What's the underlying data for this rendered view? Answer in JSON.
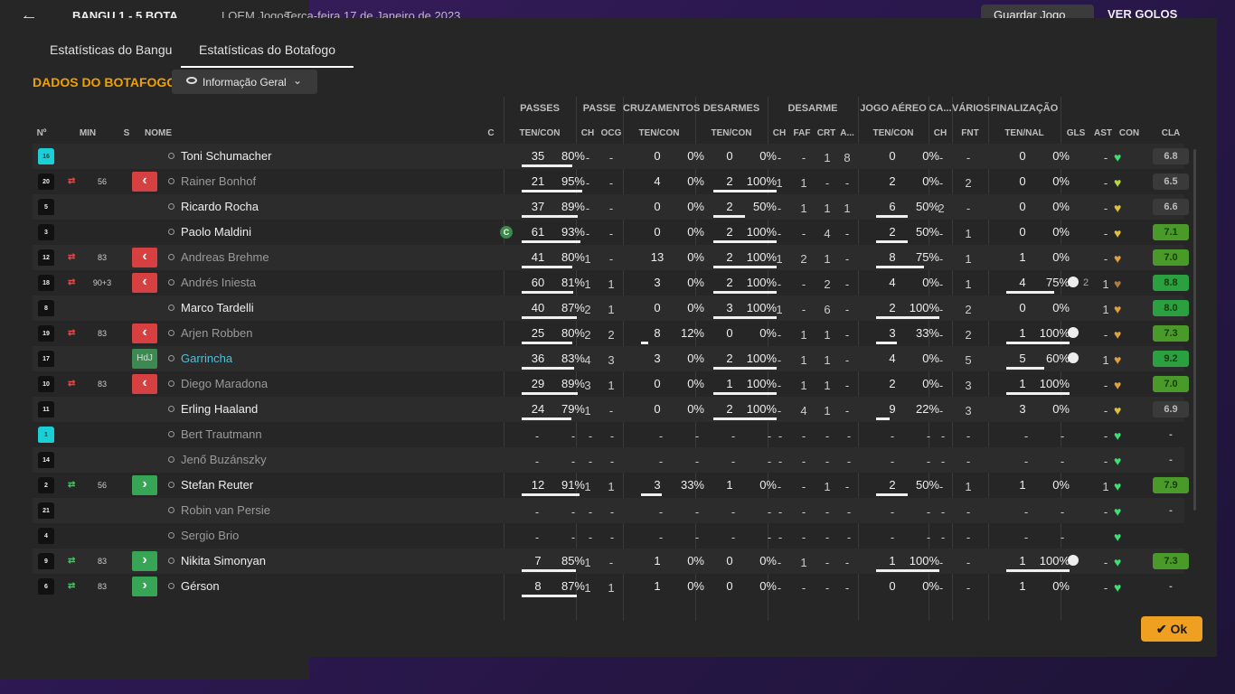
{
  "topbar": {
    "score": "BANGU  1 - 5  BOTA",
    "competition": "LOEM Jogos",
    "date": "Terça-feira 17 de Janeiro de 2023",
    "save_label": "Guardar Jogo",
    "more_label": "VER GOLOS"
  },
  "tabs": [
    {
      "label": "Estatísticas do Bangu",
      "active": false
    },
    {
      "label": "Estatísticas do Botafogo",
      "active": true
    }
  ],
  "section_title": "DADOS DO BOTAFOGO",
  "view_dropdown": {
    "selected": "Informação Geral"
  },
  "groups": {
    "passes": "PASSES",
    "passe": "PASSE",
    "cruzamentos": "CRUZAMENTOS",
    "desarmes1": "DESARMES",
    "desarme": "DESARME",
    "jogo_aereo": "JOGO AÉREO",
    "ca": "CA...",
    "varios": "VÁRIOS",
    "finalizacao": "FINALIZAÇÃO"
  },
  "columns": {
    "no": "Nº",
    "min": "MIN",
    "s": "S",
    "nome": "NOME",
    "c": "C",
    "passes_ten": "TEN/CON",
    "passe_ch": "CH",
    "passe_ocg": "OCG",
    "cruz_ten": "TEN/CON",
    "des_ten": "TEN/CON",
    "dese_ch": "CH",
    "dese_faf": "FAF",
    "dese_crt": "CRT",
    "dese_a": "A...",
    "aereo_ten": "TEN/CON",
    "ca_ch": "CH",
    "var_fnt": "FNT",
    "fin_ten": "TEN/NAL",
    "gls": "GLS",
    "ast": "AST",
    "con": "CON",
    "cla": "CLA"
  },
  "players": [
    {
      "no": "16",
      "gk": true,
      "sub": "",
      "min": "",
      "s": "",
      "name": "Toni Schumacher",
      "style": "normal",
      "captain": false,
      "pas": [
        "35",
        "80%"
      ],
      "pasw": 0.8,
      "ch": "-",
      "ocg": "-",
      "cru": [
        "0",
        "0%"
      ],
      "cruw": 0,
      "des": [
        "0",
        "0%"
      ],
      "desw": 0,
      "dch": "-",
      "faf": "-",
      "crt": "1",
      "aa": "8",
      "aer": [
        "0",
        "0%"
      ],
      "aerw": 0,
      "cach": "-",
      "fnt": "-",
      "fin": [
        "0",
        "0%"
      ],
      "finw": 0,
      "gls": "",
      "ast": "-",
      "heart": "#3ce070",
      "rating": "6.8",
      "rbg": "#3a3a3a"
    },
    {
      "no": "20",
      "gk": false,
      "sub": "out",
      "min": "56",
      "s": "red",
      "name": "Rainer Bonhof",
      "style": "dim",
      "captain": false,
      "pas": [
        "21",
        "95%"
      ],
      "pasw": 0.95,
      "ch": "-",
      "ocg": "-",
      "cru": [
        "4",
        "0%"
      ],
      "cruw": 0,
      "des": [
        "2",
        "100%"
      ],
      "desw": 1,
      "dch": "1",
      "faf": "1",
      "crt": "-",
      "aa": "-",
      "aer": [
        "2",
        "0%"
      ],
      "aerw": 0,
      "cach": "-",
      "fnt": "2",
      "fin": [
        "0",
        "0%"
      ],
      "finw": 0,
      "gls": "",
      "ast": "-",
      "heart": "#b5d840",
      "rating": "6.5",
      "rbg": "#3a3a3a"
    },
    {
      "no": "5",
      "gk": false,
      "sub": "",
      "min": "",
      "s": "",
      "name": "Ricardo Rocha",
      "style": "normal",
      "captain": false,
      "pas": [
        "37",
        "89%"
      ],
      "pasw": 0.89,
      "ch": "-",
      "ocg": "-",
      "cru": [
        "0",
        "0%"
      ],
      "cruw": 0,
      "des": [
        "2",
        "50%"
      ],
      "desw": 0.5,
      "dch": "-",
      "faf": "1",
      "crt": "1",
      "aa": "1",
      "aer": [
        "6",
        "50%"
      ],
      "aerw": 0.5,
      "cach": "2",
      "fnt": "-",
      "fin": [
        "0",
        "0%"
      ],
      "finw": 0,
      "gls": "",
      "ast": "-",
      "heart": "#e0c040",
      "rating": "6.6",
      "rbg": "#3a3a3a"
    },
    {
      "no": "3",
      "gk": false,
      "sub": "",
      "min": "",
      "s": "",
      "name": "Paolo Maldini",
      "style": "normal",
      "captain": true,
      "pas": [
        "61",
        "93%"
      ],
      "pasw": 0.93,
      "ch": "-",
      "ocg": "-",
      "cru": [
        "0",
        "0%"
      ],
      "cruw": 0,
      "des": [
        "2",
        "100%"
      ],
      "desw": 1,
      "dch": "-",
      "faf": "-",
      "crt": "4",
      "aa": "-",
      "aer": [
        "2",
        "50%"
      ],
      "aerw": 0.5,
      "cach": "-",
      "fnt": "1",
      "fin": [
        "0",
        "0%"
      ],
      "finw": 0,
      "gls": "",
      "ast": "-",
      "heart": "#e0c040",
      "rating": "7.1",
      "rbg": "#4a9a2a"
    },
    {
      "no": "12",
      "gk": false,
      "sub": "out",
      "min": "83",
      "s": "red",
      "name": "Andreas Brehme",
      "style": "dim",
      "captain": false,
      "pas": [
        "41",
        "80%"
      ],
      "pasw": 0.8,
      "ch": "1",
      "ocg": "-",
      "cru": [
        "13",
        "0%"
      ],
      "cruw": 0,
      "des": [
        "2",
        "100%"
      ],
      "desw": 1,
      "dch": "1",
      "faf": "2",
      "crt": "1",
      "aa": "-",
      "aer": [
        "8",
        "75%"
      ],
      "aerw": 0.75,
      "cach": "-",
      "fnt": "1",
      "fin": [
        "1",
        "0%"
      ],
      "finw": 0,
      "gls": "",
      "ast": "-",
      "heart": "#e0a040",
      "rating": "7.0",
      "rbg": "#4a9a2a"
    },
    {
      "no": "18",
      "gk": false,
      "sub": "out",
      "min": "90+3",
      "s": "red",
      "name": "Andrés Iniesta",
      "style": "dim",
      "captain": false,
      "pas": [
        "60",
        "81%"
      ],
      "pasw": 0.81,
      "ch": "1",
      "ocg": "1",
      "cru": [
        "3",
        "0%"
      ],
      "cruw": 0,
      "des": [
        "2",
        "100%"
      ],
      "desw": 1,
      "dch": "-",
      "faf": "-",
      "crt": "2",
      "aa": "-",
      "aer": [
        "4",
        "0%"
      ],
      "aerw": 0,
      "cach": "-",
      "fnt": "1",
      "fin": [
        "4",
        "75%"
      ],
      "finw": 0.75,
      "gls": "2",
      "ast": "1",
      "heart": "#b07a40",
      "rating": "8.8",
      "rbg": "#2aa040"
    },
    {
      "no": "8",
      "gk": false,
      "sub": "",
      "min": "",
      "s": "",
      "name": "Marco Tardelli",
      "style": "normal",
      "captain": false,
      "pas": [
        "40",
        "87%"
      ],
      "pasw": 0.87,
      "ch": "2",
      "ocg": "1",
      "cru": [
        "0",
        "0%"
      ],
      "cruw": 0,
      "des": [
        "3",
        "100%"
      ],
      "desw": 1,
      "dch": "1",
      "faf": "-",
      "crt": "6",
      "aa": "-",
      "aer": [
        "2",
        "100%"
      ],
      "aerw": 1,
      "cach": "-",
      "fnt": "2",
      "fin": [
        "0",
        "0%"
      ],
      "finw": 0,
      "gls": "",
      "ast": "1",
      "heart": "#e0a040",
      "rating": "8.0",
      "rbg": "#2aa040"
    },
    {
      "no": "19",
      "gk": false,
      "sub": "out",
      "min": "83",
      "s": "red",
      "name": "Arjen Robben",
      "style": "dim",
      "captain": false,
      "pas": [
        "25",
        "80%"
      ],
      "pasw": 0.8,
      "ch": "2",
      "ocg": "2",
      "cru": [
        "8",
        "12%"
      ],
      "cruw": 0.12,
      "des": [
        "0",
        "0%"
      ],
      "desw": 0,
      "dch": "-",
      "faf": "1",
      "crt": "1",
      "aa": "-",
      "aer": [
        "3",
        "33%"
      ],
      "aerw": 0.33,
      "cach": "-",
      "fnt": "2",
      "fin": [
        "1",
        "100%"
      ],
      "finw": 1,
      "gls": "1",
      "ast": "-",
      "heart": "#e0a040",
      "rating": "7.3",
      "rbg": "#4a9a2a"
    },
    {
      "no": "17",
      "gk": false,
      "sub": "",
      "min": "",
      "s": "hdj",
      "name": "Garrincha",
      "style": "link",
      "captain": false,
      "pas": [
        "36",
        "83%"
      ],
      "pasw": 0.83,
      "ch": "4",
      "ocg": "3",
      "cru": [
        "3",
        "0%"
      ],
      "cruw": 0,
      "des": [
        "2",
        "100%"
      ],
      "desw": 1,
      "dch": "-",
      "faf": "1",
      "crt": "1",
      "aa": "-",
      "aer": [
        "4",
        "0%"
      ],
      "aerw": 0,
      "cach": "-",
      "fnt": "5",
      "fin": [
        "5",
        "60%"
      ],
      "finw": 0.6,
      "gls": "1",
      "ast": "1",
      "heart": "#e0a040",
      "rating": "9.2",
      "rbg": "#2aa040"
    },
    {
      "no": "10",
      "gk": false,
      "sub": "out",
      "min": "83",
      "s": "red",
      "name": "Diego Maradona",
      "style": "dim",
      "captain": false,
      "pas": [
        "29",
        "89%"
      ],
      "pasw": 0.89,
      "ch": "3",
      "ocg": "1",
      "cru": [
        "0",
        "0%"
      ],
      "cruw": 0,
      "des": [
        "1",
        "100%"
      ],
      "desw": 1,
      "dch": "-",
      "faf": "1",
      "crt": "1",
      "aa": "-",
      "aer": [
        "2",
        "0%"
      ],
      "aerw": 0,
      "cach": "-",
      "fnt": "3",
      "fin": [
        "1",
        "100%"
      ],
      "finw": 1,
      "gls": "",
      "ast": "-",
      "heart": "#e0a040",
      "rating": "7.0",
      "rbg": "#4a9a2a"
    },
    {
      "no": "11",
      "gk": false,
      "sub": "",
      "min": "",
      "s": "",
      "name": "Erling Haaland",
      "style": "normal",
      "captain": false,
      "pas": [
        "24",
        "79%"
      ],
      "pasw": 0.79,
      "ch": "1",
      "ocg": "-",
      "cru": [
        "0",
        "0%"
      ],
      "cruw": 0,
      "des": [
        "2",
        "100%"
      ],
      "desw": 1,
      "dch": "-",
      "faf": "4",
      "crt": "1",
      "aa": "-",
      "aer": [
        "9",
        "22%"
      ],
      "aerw": 0.22,
      "cach": "-",
      "fnt": "3",
      "fin": [
        "3",
        "0%"
      ],
      "finw": 0,
      "gls": "",
      "ast": "-",
      "heart": "#e0c040",
      "rating": "6.9",
      "rbg": "#3a3a3a"
    },
    {
      "no": "1",
      "gk": true,
      "sub": "",
      "min": "",
      "s": "",
      "name": "Bert Trautmann",
      "style": "dim",
      "captain": false,
      "empty": true,
      "gls": "",
      "ast": "-",
      "heart": "#3ce070",
      "rating": "-",
      "rbg": "transparent"
    },
    {
      "no": "14",
      "gk": false,
      "sub": "",
      "min": "",
      "s": "",
      "name": "Jenő Buzánszky",
      "style": "dim",
      "captain": false,
      "empty": true,
      "gls": "",
      "ast": "-",
      "heart": "#3ce070",
      "rating": "-",
      "rbg": "transparent"
    },
    {
      "no": "2",
      "gk": false,
      "sub": "in",
      "min": "56",
      "s": "green",
      "name": "Stefan Reuter",
      "style": "normal",
      "captain": false,
      "pas": [
        "12",
        "91%"
      ],
      "pasw": 0.91,
      "ch": "1",
      "ocg": "1",
      "cru": [
        "3",
        "33%"
      ],
      "cruw": 0.33,
      "des": [
        "1",
        "0%"
      ],
      "desw": 0,
      "dch": "-",
      "faf": "-",
      "crt": "1",
      "aa": "-",
      "aer": [
        "2",
        "50%"
      ],
      "aerw": 0.5,
      "cach": "-",
      "fnt": "1",
      "fin": [
        "1",
        "0%"
      ],
      "finw": 0,
      "gls": "",
      "ast": "1",
      "heart": "#3ce070",
      "rating": "7.9",
      "rbg": "#4a9a2a"
    },
    {
      "no": "21",
      "gk": false,
      "sub": "",
      "min": "",
      "s": "",
      "name": "Robin van Persie",
      "style": "dim",
      "captain": false,
      "empty": true,
      "gls": "",
      "ast": "-",
      "heart": "#3ce070",
      "rating": "-",
      "rbg": "transparent"
    },
    {
      "no": "4",
      "gk": false,
      "sub": "",
      "min": "",
      "s": "",
      "name": "Sergio Brio",
      "style": "dim",
      "captain": false,
      "empty": true,
      "gls": "",
      "ast": "",
      "heart": "#3ce070",
      "rating": "",
      "rbg": "transparent"
    },
    {
      "no": "9",
      "gk": false,
      "sub": "in",
      "min": "83",
      "s": "green",
      "name": "Nikita Simonyan",
      "style": "normal",
      "captain": false,
      "pas": [
        "7",
        "85%"
      ],
      "pasw": 0.85,
      "ch": "1",
      "ocg": "-",
      "cru": [
        "1",
        "0%"
      ],
      "cruw": 0,
      "des": [
        "0",
        "0%"
      ],
      "desw": 0,
      "dch": "-",
      "faf": "1",
      "crt": "-",
      "aa": "-",
      "aer": [
        "1",
        "100%"
      ],
      "aerw": 1,
      "cach": "-",
      "fnt": "-",
      "fin": [
        "1",
        "100%"
      ],
      "finw": 1,
      "gls": "1",
      "ast": "-",
      "heart": "#3ce070",
      "rating": "7.3",
      "rbg": "#4a9a2a"
    },
    {
      "no": "6",
      "gk": false,
      "sub": "in",
      "min": "83",
      "s": "green",
      "name": "Gérson",
      "style": "normal",
      "captain": false,
      "pas": [
        "8",
        "87%"
      ],
      "pasw": 0.87,
      "ch": "1",
      "ocg": "1",
      "cru": [
        "1",
        "0%"
      ],
      "cruw": 0,
      "des": [
        "0",
        "0%"
      ],
      "desw": 0,
      "dch": "-",
      "faf": "-",
      "crt": "-",
      "aa": "-",
      "aer": [
        "0",
        "0%"
      ],
      "aerw": 0,
      "cach": "-",
      "fnt": "-",
      "fin": [
        "1",
        "0%"
      ],
      "finw": 0,
      "gls": "",
      "ast": "-",
      "heart": "#3ce070",
      "rating": "-",
      "rbg": "transparent"
    }
  ],
  "ok_label": "Ok",
  "s_labels": {
    "red": "‹",
    "green": "›",
    "hdj": "HdJ"
  },
  "captain_letter": "C"
}
